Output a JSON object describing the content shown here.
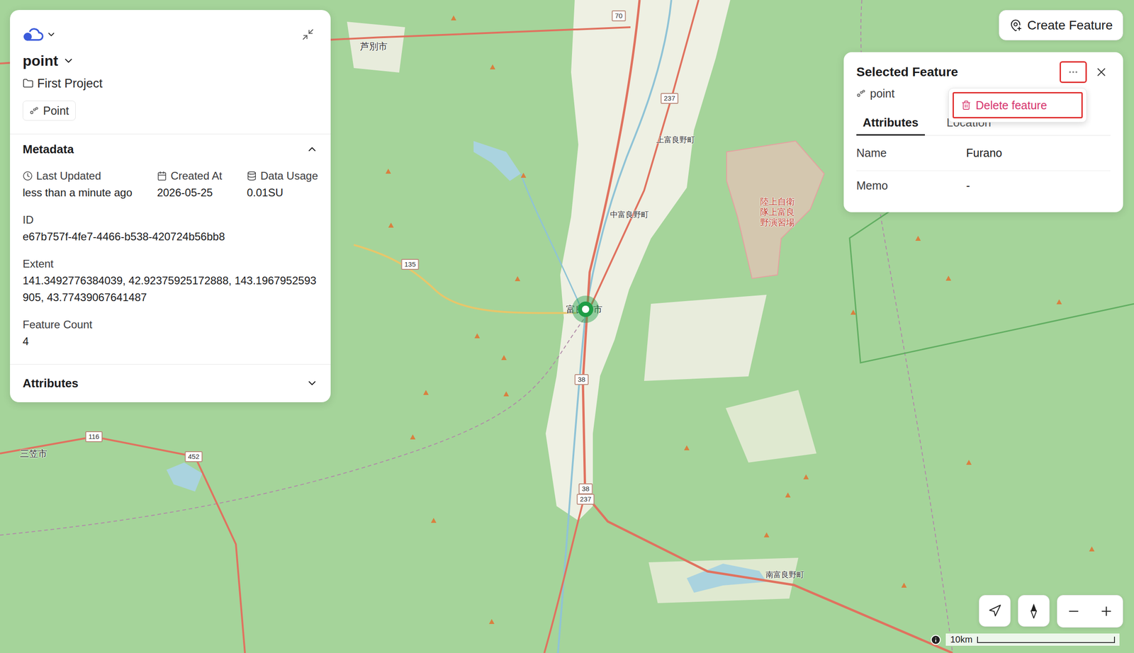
{
  "workspace": {
    "switcher_expanded": false
  },
  "layer_panel": {
    "title": "point",
    "project": "First Project",
    "geometry_type": "Point",
    "collapsed": false,
    "metadata_section": {
      "title": "Metadata",
      "expanded": true
    },
    "stats": [
      {
        "label": "Last Updated",
        "value": "less than a minute ago"
      },
      {
        "label": "Created At",
        "value": "2026-05-25"
      },
      {
        "label": "Data Usage",
        "value": "0.01SU"
      }
    ],
    "fields": [
      {
        "label": "ID",
        "value": "e67b757f-4fe7-4466-b538-420724b56bb8"
      },
      {
        "label": "Extent",
        "value": "141.3492776384039, 42.92375925172888, 143.1967952593905, 43.77439067641487"
      },
      {
        "label": "Feature Count",
        "value": "4"
      }
    ],
    "attributes_section": {
      "title": "Attributes",
      "expanded": false
    }
  },
  "create_feature": {
    "label": "Create Feature"
  },
  "selected_feature": {
    "title": "Selected Feature",
    "layer": "point",
    "more_button": {
      "highlighted": true
    },
    "tabs": [
      {
        "label": "Attributes",
        "selected": true
      },
      {
        "label": "Location",
        "selected": false
      }
    ],
    "attributes": [
      {
        "name": "Name",
        "value": "Furano"
      },
      {
        "name": "Memo",
        "value": "-"
      }
    ],
    "menu": {
      "open": true,
      "items": [
        {
          "label": "Delete feature",
          "kind": "danger",
          "highlighted": true
        }
      ]
    }
  },
  "map": {
    "labels": [
      {
        "text": "芦別市",
        "kind": "city"
      },
      {
        "text": "上富良野町",
        "kind": "town"
      },
      {
        "text": "中富良野町",
        "kind": "town"
      },
      {
        "text": "陸上自衛隊上富良野演習場",
        "kind": "area"
      },
      {
        "text": "富良野市",
        "kind": "city"
      },
      {
        "text": "三笠市",
        "kind": "city"
      },
      {
        "text": "南富良野町",
        "kind": "town"
      },
      {
        "text": "70",
        "kind": "road"
      },
      {
        "text": "237",
        "kind": "road"
      },
      {
        "text": "135",
        "kind": "road"
      },
      {
        "text": "38",
        "kind": "road"
      },
      {
        "text": "116",
        "kind": "road"
      },
      {
        "text": "452",
        "kind": "road"
      },
      {
        "text": "38",
        "kind": "road"
      },
      {
        "text": "237",
        "kind": "road"
      }
    ],
    "marker": {
      "selected": true
    },
    "scale": {
      "label": "10km"
    }
  }
}
